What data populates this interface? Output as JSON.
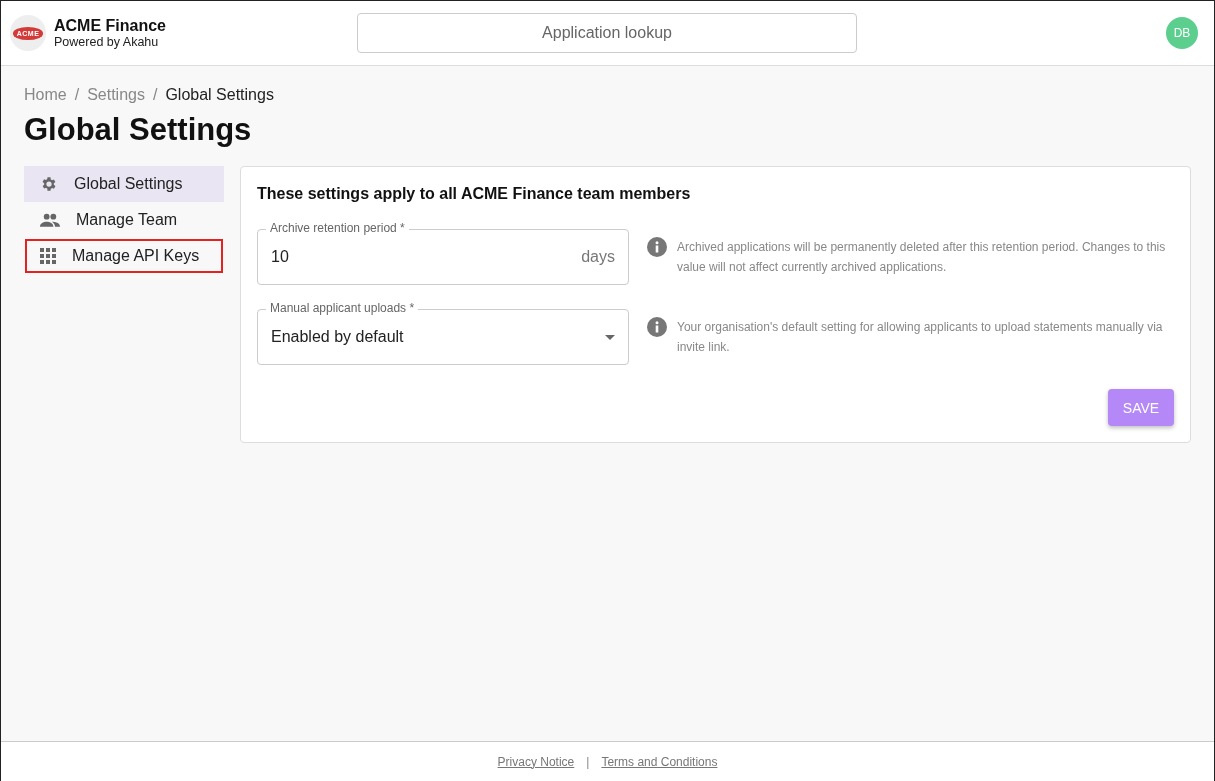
{
  "header": {
    "logo_text": "ACME",
    "brand": "ACME Finance",
    "tagline": "Powered by Akahu",
    "search": {
      "placeholder": "Application lookup"
    },
    "avatar": "DB"
  },
  "breadcrumbs": [
    {
      "label": "Home",
      "current": false
    },
    {
      "label": "Settings",
      "current": false
    },
    {
      "label": "Global Settings",
      "current": true
    }
  ],
  "separator": "/",
  "title": "Global Settings",
  "sidebar": {
    "items": [
      {
        "label": "Global Settings",
        "kind": "gear",
        "selected": true,
        "highlighted": false
      },
      {
        "label": "Manage Team",
        "kind": "people",
        "selected": false,
        "highlighted": false
      },
      {
        "label": "Manage API Keys",
        "kind": "grid",
        "selected": false,
        "highlighted": true
      }
    ]
  },
  "panel": {
    "heading": "These settings apply to all ACME Finance team members",
    "fields": [
      {
        "kind": "text",
        "label": "Archive retention period *",
        "value": "10",
        "suffix": "days",
        "help": "Archived applications will be permanently deleted after this retention period. Changes to this value will not affect currently archived applications."
      },
      {
        "kind": "select",
        "label": "Manual applicant uploads *",
        "value": "Enabled by default",
        "help": "Your organisation's default setting for allowing applicants to upload statements manually via invite link."
      }
    ],
    "save": "SAVE"
  },
  "footer": {
    "links": [
      "Privacy Notice",
      "Terms and Conditions"
    ],
    "divider": "|"
  }
}
